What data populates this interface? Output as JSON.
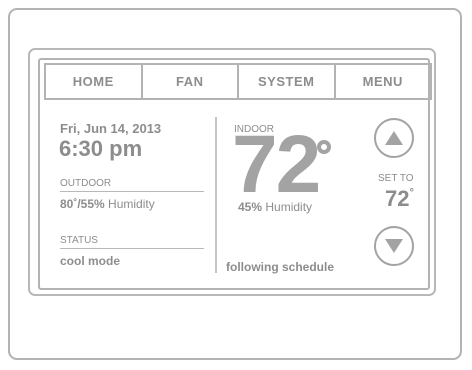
{
  "nav": {
    "items": [
      {
        "label": "HOME"
      },
      {
        "label": "FAN"
      },
      {
        "label": "SYSTEM"
      },
      {
        "label": "MENU"
      }
    ]
  },
  "left_panel": {
    "date": "Fri, Jun 14, 2013",
    "time": "6:30 pm",
    "outdoor_label": "OUTDOOR",
    "outdoor_temp": "80˚/55%",
    "outdoor_humidity_word": "Humidity",
    "status_label": "STATUS",
    "status_value": "cool mode"
  },
  "center_panel": {
    "indoor_label": "INDOOR",
    "indoor_temp": "72",
    "indoor_humidity_value": "45%",
    "indoor_humidity_word": "Humidity",
    "schedule_text": "following schedule"
  },
  "right_panel": {
    "set_to_label": "SET TO",
    "set_to_value": "72",
    "set_to_degree": "°"
  },
  "colors": {
    "text_gray": "#8d8d8d",
    "temp_gray": "#a3a3a3",
    "border_gray": "#b3b3b3"
  },
  "icons": {
    "up": "triangle-up-icon",
    "down": "triangle-down-icon",
    "degree": "degree-ring-icon"
  }
}
